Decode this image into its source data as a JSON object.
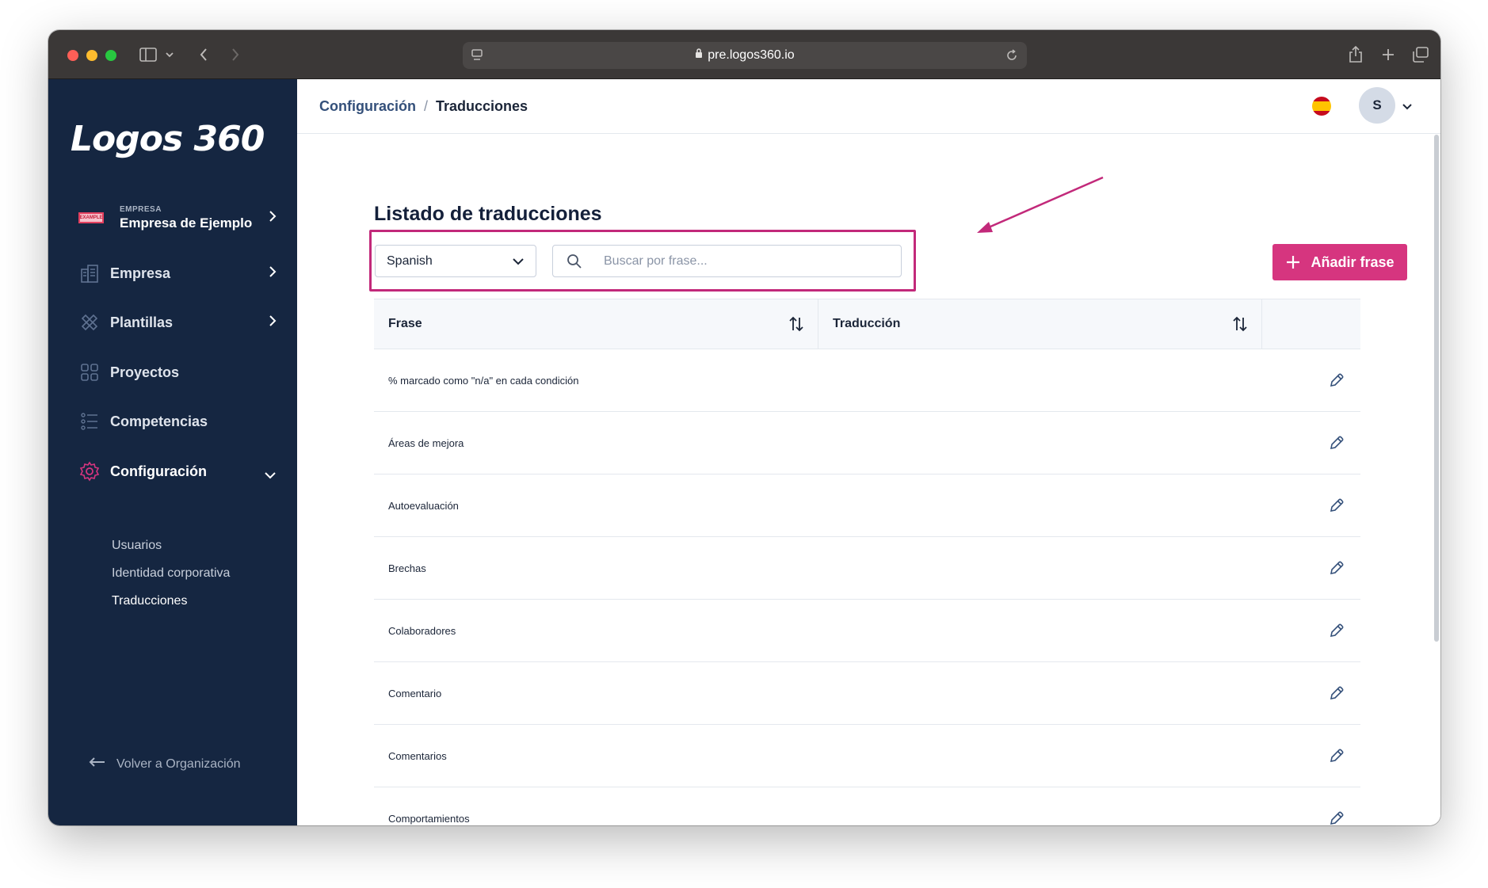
{
  "browser": {
    "url": "pre.logos360.io"
  },
  "sidebar": {
    "logo": "Logos 360",
    "company": {
      "badge": "EXAMPLE",
      "kicker": "EMPRESA",
      "name": "Empresa de Ejemplo"
    },
    "items": [
      {
        "label": "Empresa",
        "icon": "building-icon",
        "has_chevron": true
      },
      {
        "label": "Plantillas",
        "icon": "templates-icon",
        "has_chevron": true
      },
      {
        "label": "Proyectos",
        "icon": "grid-icon",
        "has_chevron": false
      },
      {
        "label": "Competencias",
        "icon": "list-icon",
        "has_chevron": false
      },
      {
        "label": "Configuración",
        "icon": "gear-icon",
        "has_chevron": true,
        "expanded": true
      }
    ],
    "subitems": [
      {
        "label": "Usuarios"
      },
      {
        "label": "Identidad corporativa"
      },
      {
        "label": "Traducciones",
        "active": true
      }
    ],
    "back_link": "Volver a Organización"
  },
  "header": {
    "breadcrumb": {
      "parent": "Configuración",
      "separator": "/",
      "current": "Traducciones"
    },
    "avatar_initial": "S",
    "language_flag": "es"
  },
  "main": {
    "title": "Listado de traducciones",
    "language_select": {
      "value": "Spanish"
    },
    "search": {
      "placeholder": "Buscar por frase...",
      "value": ""
    },
    "add_button": "Añadir frase",
    "table": {
      "columns": [
        "Frase",
        "Traducción"
      ],
      "rows": [
        {
          "frase": "% marcado como \"n/a\" en cada condición",
          "traduccion": ""
        },
        {
          "frase": "Áreas de mejora",
          "traduccion": ""
        },
        {
          "frase": "Autoevaluación",
          "traduccion": ""
        },
        {
          "frase": "Brechas",
          "traduccion": ""
        },
        {
          "frase": "Colaboradores",
          "traduccion": ""
        },
        {
          "frase": "Comentario",
          "traduccion": ""
        },
        {
          "frase": "Comentarios",
          "traduccion": ""
        },
        {
          "frase": "Comportamientos",
          "traduccion": ""
        }
      ]
    }
  },
  "colors": {
    "sidebar_bg": "#152641",
    "accent": "#d6357f",
    "annotation": "#c2297a"
  }
}
